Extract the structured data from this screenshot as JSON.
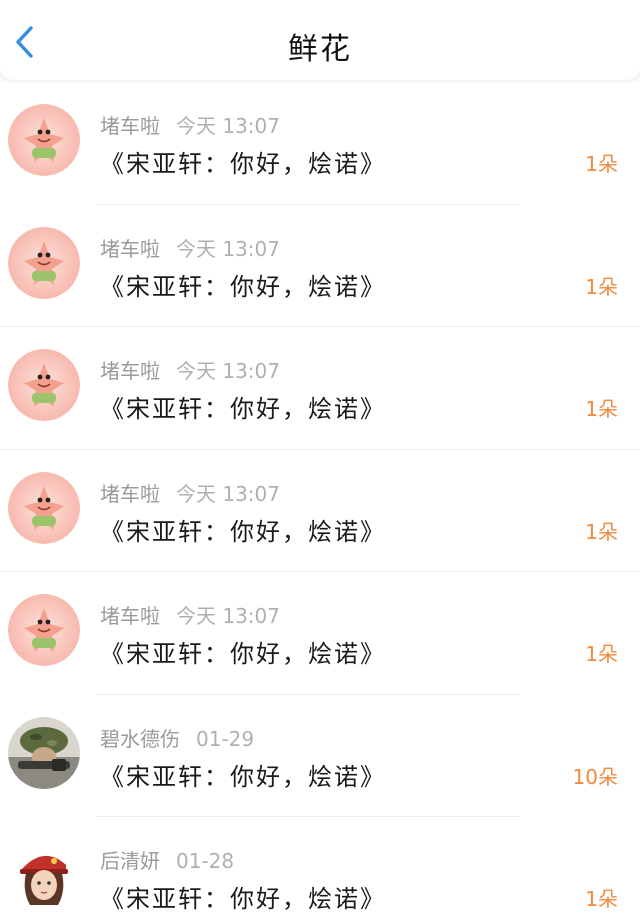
{
  "header": {
    "title": "鲜花",
    "back_icon": "chevron-left-icon",
    "accent_color": "#2f8de4"
  },
  "colors": {
    "count": "#f08a3c",
    "meta": "#9a9a9a",
    "title": "#1a1a1a"
  },
  "items": [
    {
      "sender": "堵车啦",
      "time": "今天 13:07",
      "gift": "《宋亚轩：你好，烩诺》",
      "count": "1朵",
      "avatar": "patrick-star-avatar"
    },
    {
      "sender": "堵车啦",
      "time": "今天 13:07",
      "gift": "《宋亚轩：你好，烩诺》",
      "count": "1朵",
      "avatar": "patrick-star-avatar"
    },
    {
      "sender": "堵车啦",
      "time": "今天 13:07",
      "gift": "《宋亚轩：你好，烩诺》",
      "count": "1朵",
      "avatar": "patrick-star-avatar"
    },
    {
      "sender": "堵车啦",
      "time": "今天 13:07",
      "gift": "《宋亚轩：你好，烩诺》",
      "count": "1朵",
      "avatar": "patrick-star-avatar"
    },
    {
      "sender": "堵车啦",
      "time": "今天 13:07",
      "gift": "《宋亚轩：你好，烩诺》",
      "count": "1朵",
      "avatar": "patrick-star-avatar"
    },
    {
      "sender": "碧水德伤",
      "time": "01-29",
      "gift": "《宋亚轩：你好，烩诺》",
      "count": "10朵",
      "avatar": "soldier-avatar"
    },
    {
      "sender": "后清妍",
      "time": "01-28",
      "gift": "《宋亚轩：你好，烩诺》",
      "count": "1朵",
      "avatar": "red-cap-girl-avatar"
    }
  ]
}
